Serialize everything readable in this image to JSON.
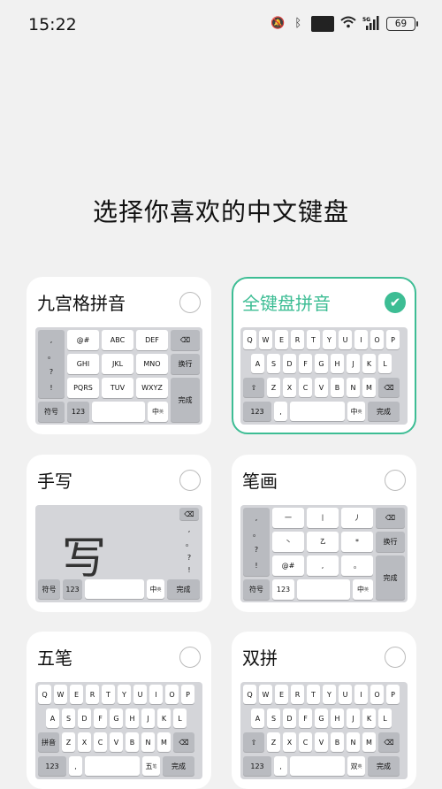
{
  "status": {
    "time": "15:22",
    "battery": "69",
    "icons": [
      "mute-bell-icon",
      "bluetooth-icon",
      "hd-icon",
      "wifi-icon",
      "5g-signal-icon",
      "battery-icon"
    ],
    "hd_label": "HD"
  },
  "title": "选择你喜欢的中文键盘",
  "accent": "#3dbd94",
  "cards": [
    {
      "name": "九宫格拼音",
      "selected": false
    },
    {
      "name": "全键盘拼音",
      "selected": true
    },
    {
      "name": "手写",
      "selected": false
    },
    {
      "name": "笔画",
      "selected": false
    },
    {
      "name": "五笔",
      "selected": false
    },
    {
      "name": "双拼",
      "selected": false
    }
  ],
  "nine_key": {
    "side": [
      ",",
      "。",
      "?",
      "!"
    ],
    "rows": [
      [
        "@#",
        "ABC",
        "DEF"
      ],
      [
        "GHI",
        "JKL",
        "MNO"
      ],
      [
        "PQRS",
        "TUV",
        "WXYZ"
      ]
    ],
    "backspace": "⌫",
    "wrap": "换行",
    "done": "完成",
    "symbols": "符号",
    "num": "123",
    "lang": "中",
    "lang_sub": "英"
  },
  "qwerty": {
    "row1": [
      "Q",
      "W",
      "E",
      "R",
      "T",
      "Y",
      "U",
      "I",
      "O",
      "P"
    ],
    "row2": [
      "A",
      "S",
      "D",
      "F",
      "G",
      "H",
      "J",
      "K",
      "L"
    ],
    "row3": [
      "Z",
      "X",
      "C",
      "V",
      "B",
      "N",
      "M"
    ],
    "shift": "⇧",
    "backspace": "⌫",
    "num": "123",
    "comma": ",",
    "punct": "。",
    "lang": "中",
    "lang_sub": "英",
    "done": "完成"
  },
  "handwriting": {
    "glyph": "写",
    "side": [
      ",",
      "。",
      "?",
      "!"
    ],
    "backspace": "⌫",
    "symbols": "符号",
    "num": "123",
    "lang": "中",
    "lang_sub": "英",
    "done": "完成"
  },
  "stroke": {
    "side": [
      ",",
      "。",
      "?",
      "!"
    ],
    "rows": [
      [
        "一",
        "丨",
        "丿"
      ],
      [
        "丶",
        "㇠",
        "*"
      ],
      [
        "@#",
        ",",
        "。"
      ]
    ],
    "backspace": "⌫",
    "wrap": "换行",
    "done": "完成",
    "symbols": "符号",
    "num": "123",
    "lang": "中",
    "lang_sub": "英"
  },
  "wubi": {
    "mode": "拼音",
    "lang": "五",
    "lang_sub": "笔"
  },
  "shuangpin": {
    "lang": "双",
    "lang_sub": "英"
  }
}
